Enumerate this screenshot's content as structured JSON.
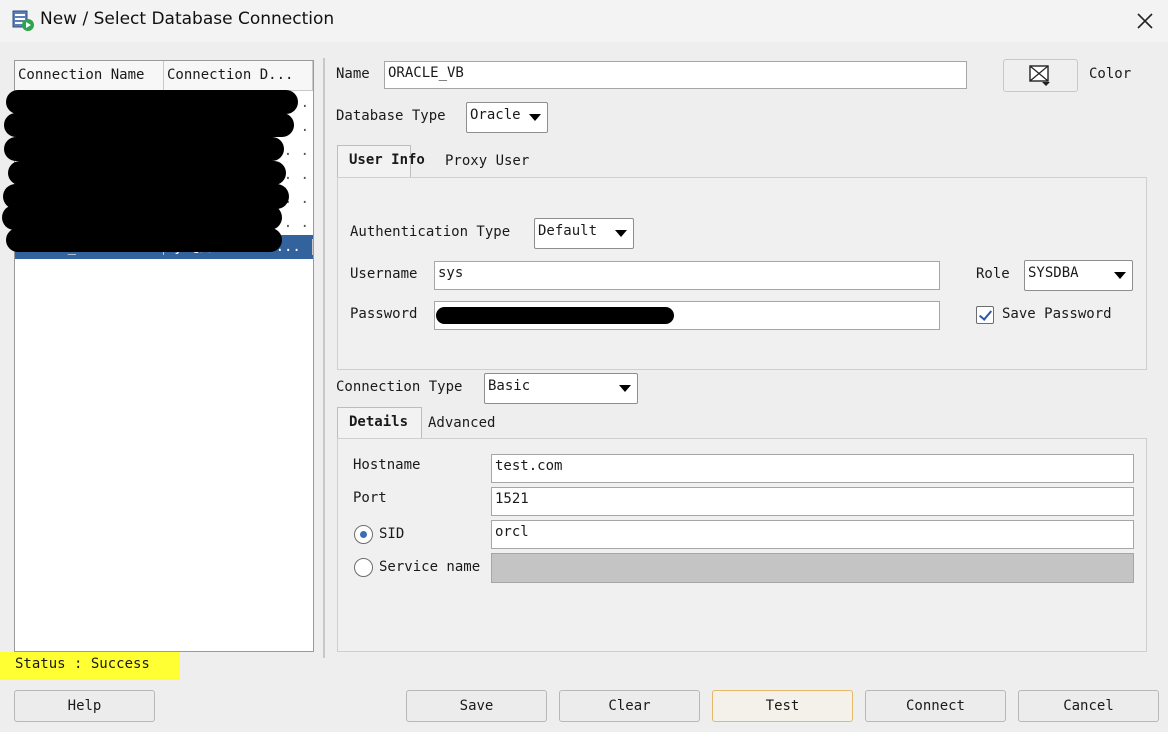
{
  "window": {
    "title": "New / Select Database Connection"
  },
  "connection_list": {
    "headers": [
      "Connection Name",
      "Connection D..."
    ],
    "selected_row": {
      "name": "ORACLE_VB",
      "details": "sys@//test.co..."
    }
  },
  "form": {
    "name_label": "Name",
    "name_value": "ORACLE_VB",
    "color_label": "Color",
    "db_type_label": "Database Type",
    "db_type_value": "Oracle",
    "tabs_top": [
      "User Info",
      "Proxy User"
    ],
    "auth_type_label": "Authentication Type",
    "auth_type_value": "Default",
    "username_label": "Username",
    "username_value": "sys",
    "role_label": "Role",
    "role_value": "SYSDBA",
    "password_label": "Password",
    "save_password_label": "Save Password",
    "save_password_checked": true,
    "conn_type_label": "Connection Type",
    "conn_type_value": "Basic",
    "tabs_bottom": [
      "Details",
      "Advanced"
    ],
    "hostname_label": "Hostname",
    "hostname_value": "test.com",
    "port_label": "Port",
    "port_value": "1521",
    "sid_label": "SID",
    "sid_value": "orcl",
    "service_name_label": "Service name"
  },
  "status": {
    "text": "Status : Success",
    "highlight_color": "#ffff33"
  },
  "buttons": {
    "help": "Help",
    "save": "Save",
    "clear": "Clear",
    "test": "Test",
    "connect": "Connect",
    "cancel": "Cancel"
  },
  "colors": {
    "selection": "#33639c",
    "accent_check": "#2b5aa3"
  }
}
